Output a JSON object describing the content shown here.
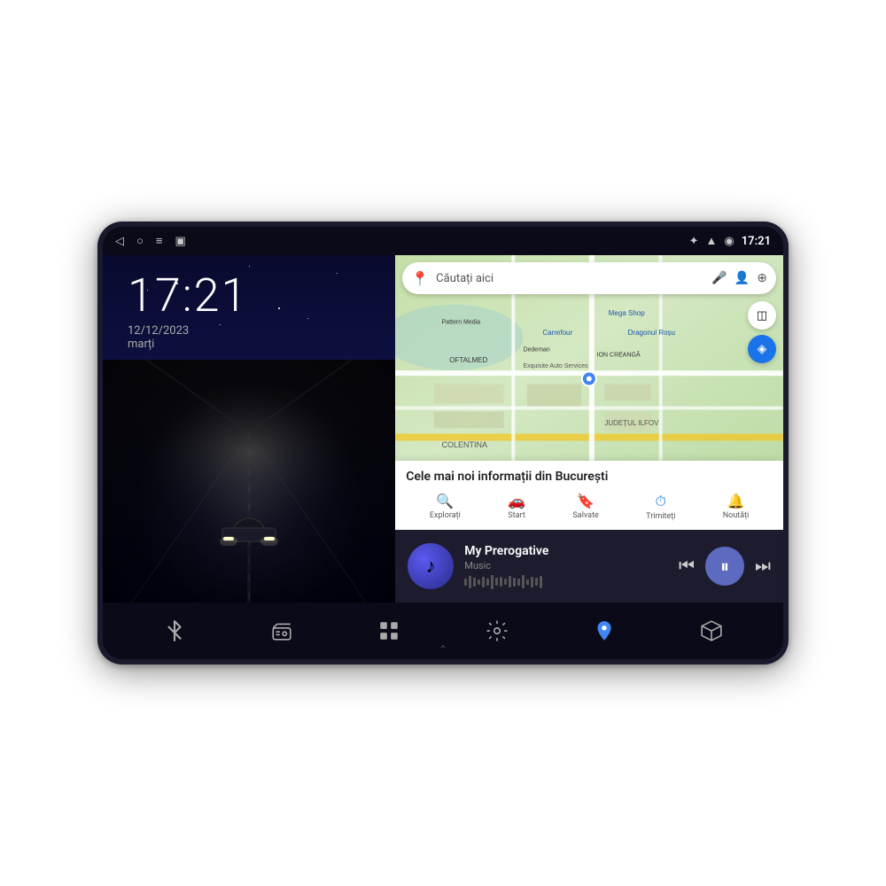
{
  "device": {
    "status_bar": {
      "back_icon": "◁",
      "circle_icon": "○",
      "menu_icon": "≡",
      "square_icon": "▣",
      "bluetooth_icon": "⚡",
      "wifi_icon": "WiFi",
      "time": "17:21"
    },
    "left_panel": {
      "clock_time": "17:21",
      "clock_date": "12/12/2023",
      "clock_day": "marți"
    },
    "right_panel": {
      "map": {
        "search_placeholder": "Căutați aici",
        "info_title": "Cele mai noi informații din București",
        "nav_tabs": [
          {
            "label": "Explorați",
            "icon": "🔍"
          },
          {
            "label": "Start",
            "icon": "🚗"
          },
          {
            "label": "Salvate",
            "icon": "🔖"
          },
          {
            "label": "Trimiteți",
            "icon": "⏱"
          },
          {
            "label": "Noutăți",
            "icon": "🔔"
          }
        ]
      },
      "music": {
        "title": "My Prerogative",
        "subtitle": "Music",
        "album_icon": "♪"
      }
    },
    "bottom_toolbar": {
      "buttons": [
        {
          "name": "bluetooth",
          "icon": "⚡"
        },
        {
          "name": "radio",
          "icon": "📻"
        },
        {
          "name": "apps",
          "icon": "⊞"
        },
        {
          "name": "settings",
          "icon": "⚙"
        },
        {
          "name": "maps",
          "icon": "📍"
        },
        {
          "name": "box",
          "icon": "⬡"
        }
      ],
      "chevron": "⌃"
    }
  }
}
